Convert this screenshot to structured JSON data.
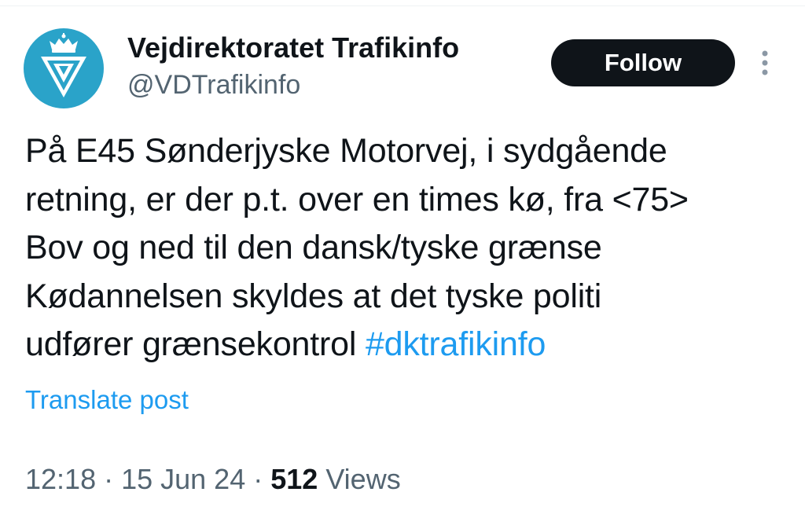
{
  "author": {
    "display_name": "Vejdirektoratet Trafikinfo",
    "handle": "@VDTrafikinfo",
    "avatar_icon": "crown-road-sign-logo-icon",
    "avatar_color": "#2aa3c9"
  },
  "actions": {
    "follow_label": "Follow",
    "more_icon": "vertical-ellipsis-icon"
  },
  "post": {
    "lines": [
      "På E45 Sønderjyske Motorvej, i sydgående",
      "retning, er der p.t. over en times kø, fra <75>",
      "Bov og ned til den dansk/tyske grænse",
      "Kødannelsen skyldes at det tyske politi",
      "udfører grænsekontrol "
    ],
    "hashtag": "#dktrafikinfo",
    "translate_label": "Translate post"
  },
  "meta": {
    "time": "12:18",
    "separator": " · ",
    "date": "15 Jun 24",
    "views_count": "512",
    "views_label": " Views"
  },
  "colors": {
    "link": "#1d9bf0",
    "text_primary": "#0f1419",
    "text_secondary": "#536471",
    "button_bg": "#0f1419"
  }
}
